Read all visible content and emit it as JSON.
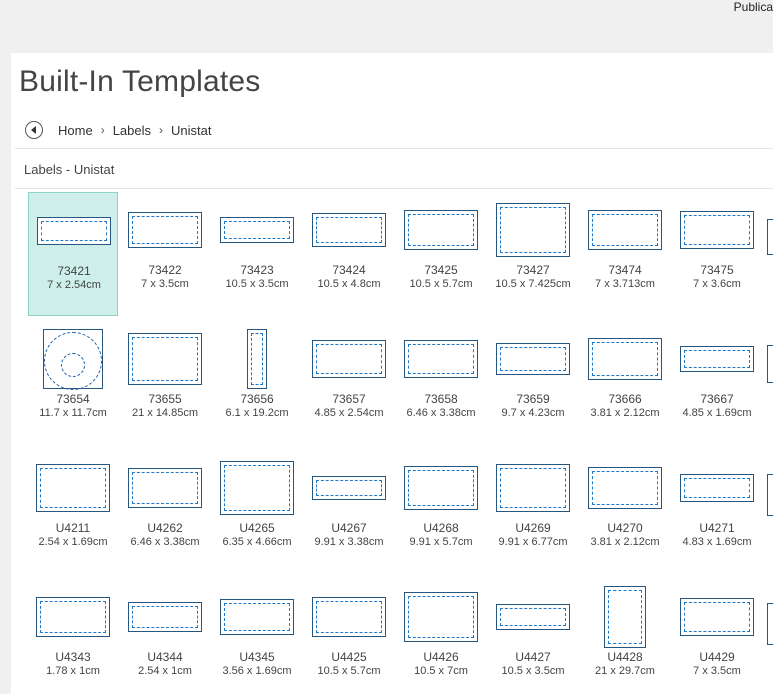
{
  "app": {
    "name": "Publica"
  },
  "header": {
    "title": "Built-In Templates"
  },
  "breadcrumb": {
    "items": [
      "Home",
      "Labels",
      "Unistat"
    ],
    "separator": "›"
  },
  "section": {
    "label": "Labels - Unistat"
  },
  "colors": {
    "selected_bg": "#cdeee9",
    "label_border": "#27577e",
    "label_dash": "#1f78c8"
  },
  "templates": [
    {
      "name": "73421",
      "size": "7 x 2.54cm",
      "selected": true
    },
    {
      "name": "73422",
      "size": "7 x 3.5cm"
    },
    {
      "name": "73423",
      "size": "10.5 x 3.5cm"
    },
    {
      "name": "73424",
      "size": "10.5 x 4.8cm"
    },
    {
      "name": "73425",
      "size": "10.5 x 5.7cm"
    },
    {
      "name": "73427",
      "size": "10.5 x 7.425cm"
    },
    {
      "name": "73474",
      "size": "7 x 3.713cm"
    },
    {
      "name": "73475",
      "size": "7 x 3.6cm"
    },
    {
      "name": "73654",
      "size": "11.7 x 11.7cm",
      "icon": "cd-label-icon"
    },
    {
      "name": "73655",
      "size": "21 x 14.85cm"
    },
    {
      "name": "73656",
      "size": "6.1 x 19.2cm"
    },
    {
      "name": "73657",
      "size": "4.85 x 2.54cm"
    },
    {
      "name": "73658",
      "size": "6.46 x 3.38cm"
    },
    {
      "name": "73659",
      "size": "9.7 x 4.23cm"
    },
    {
      "name": "73666",
      "size": "3.81 x 2.12cm"
    },
    {
      "name": "73667",
      "size": "4.85 x 1.69cm"
    },
    {
      "name": "U4211",
      "size": "2.54 x 1.69cm"
    },
    {
      "name": "U4262",
      "size": "6.46 x 3.38cm"
    },
    {
      "name": "U4265",
      "size": "6.35 x 4.66cm"
    },
    {
      "name": "U4267",
      "size": "9.91 x 3.38cm"
    },
    {
      "name": "U4268",
      "size": "9.91 x 5.7cm"
    },
    {
      "name": "U4269",
      "size": "9.91 x 6.77cm"
    },
    {
      "name": "U4270",
      "size": "3.81 x 2.12cm"
    },
    {
      "name": "U4271",
      "size": "4.83 x 1.69cm"
    },
    {
      "name": "U4343",
      "size": "1.78 x 1cm"
    },
    {
      "name": "U4344",
      "size": "2.54 x 1cm"
    },
    {
      "name": "U4345",
      "size": "3.56 x 1.69cm"
    },
    {
      "name": "U4425",
      "size": "10.5 x 5.7cm"
    },
    {
      "name": "U4426",
      "size": "10.5 x 7cm"
    },
    {
      "name": "U4427",
      "size": "10.5 x 3.5cm"
    },
    {
      "name": "U4428",
      "size": "21 x 29.7cm"
    },
    {
      "name": "U4429",
      "size": "7 x 3.5cm"
    }
  ]
}
